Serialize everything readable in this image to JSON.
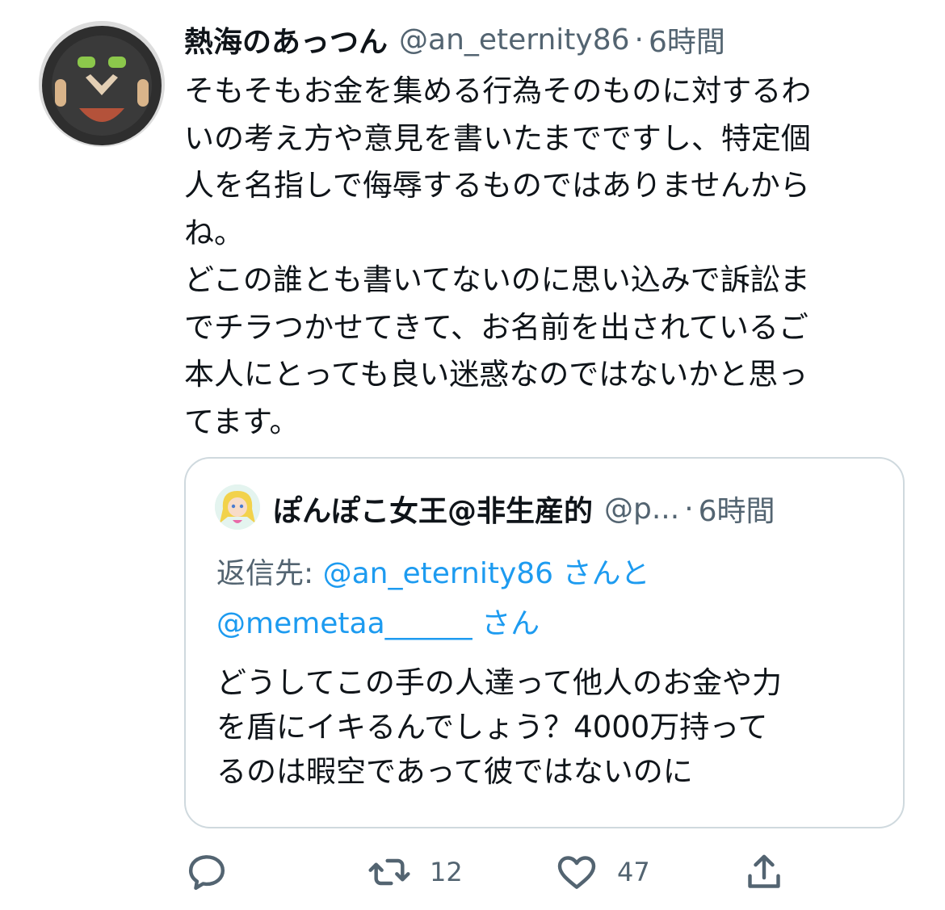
{
  "tweet": {
    "author": {
      "display_name": "熱海のあっつん",
      "handle": "@an_eternity86"
    },
    "separator": "·",
    "time": "6時間",
    "text_lines": [
      "そもそもお金を集める行為そのものに対するわ",
      "いの考え方や意見を書いたまでですし、特定個",
      "人を名指しで侮辱するものではありませんから",
      "ね。",
      "どこの誰とも書いてないのに思い込みで訴訟ま",
      "でチラつかせてきて、お名前を出されているご",
      "本人にとっても良い迷惑なのではないかと思っ",
      "てます。"
    ]
  },
  "quoted_tweet": {
    "author": {
      "display_name": "ぽんぽこ女王@非生産的",
      "handle_truncated": "@p..."
    },
    "separator": "·",
    "time": "6時間",
    "reply_to": {
      "prefix": "返信先: ",
      "user1": "@an_eternity86",
      "mid": " さんと",
      "user2": "@memetaa______",
      "suffix": " さん"
    },
    "text_lines": [
      "どうしてこの手の人達って他人のお金や力",
      "を盾にイキるんでしょう？4000万持って",
      "るのは暇空であって彼ではないのに"
    ]
  },
  "actions": {
    "reply": {
      "icon": "reply-icon"
    },
    "retweet": {
      "icon": "retweet-icon",
      "count": "12"
    },
    "like": {
      "icon": "heart-icon",
      "count": "47"
    },
    "share": {
      "icon": "share-icon"
    }
  },
  "colors": {
    "text": "#0f1419",
    "secondary": "#536471",
    "link": "#1d9bf0",
    "border": "#cfd9de"
  }
}
